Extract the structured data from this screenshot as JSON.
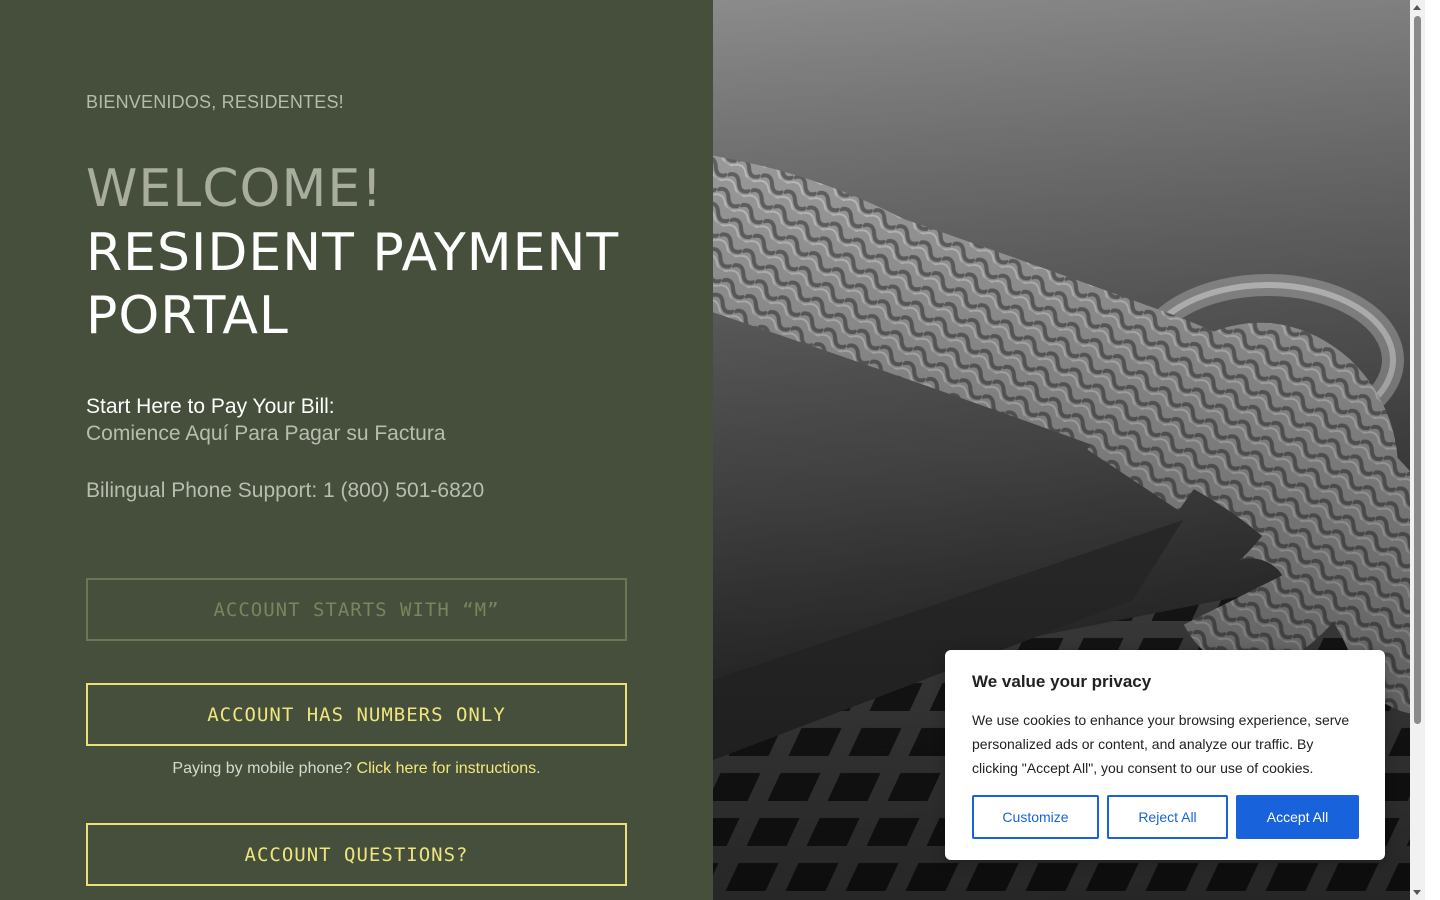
{
  "portal": {
    "eyebrow": "BIENVENIDOS, RESIDENTES!",
    "welcome": "WELCOME!",
    "title_line1": "RESIDENT PAYMENT",
    "title_line2": "PORTAL",
    "start_here": "Start Here to Pay Your Bill:",
    "start_here_es": "Comience Aquí Para Pagar su Factura",
    "phone_support": "Bilingual Phone Support: 1 (800) 501-6820"
  },
  "buttons": {
    "account_m": "ACCOUNT STARTS WITH “M”",
    "account_numbers": "ACCOUNT HAS NUMBERS ONLY",
    "account_questions": "ACCOUNT QUESTIONS?"
  },
  "mobile_note": {
    "prefix": "Paying by mobile phone? ",
    "link": "Click here for instructions",
    "suffix": "."
  },
  "cookie": {
    "title": "We value your privacy",
    "text": "We use cookies to enhance your browsing experience, serve personalized ads or content, and analyze our traffic. By clicking \"Accept All\", you consent to our use of cookies.",
    "customize": "Customize",
    "reject": "Reject All",
    "accept": "Accept All"
  },
  "colors": {
    "panel_bg": "#454f3b",
    "accent_yellow": "#eee57e",
    "cookie_blue": "#1863dc"
  },
  "image": {
    "subject": "rope-knot-photo"
  }
}
